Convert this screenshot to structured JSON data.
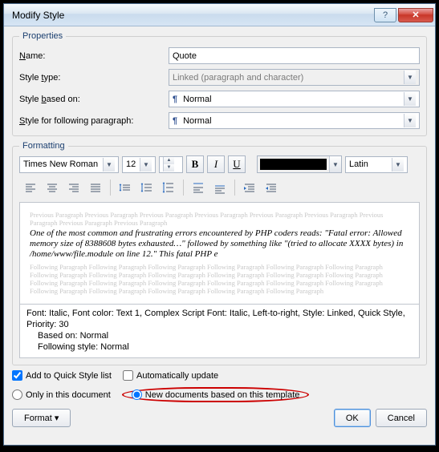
{
  "window": {
    "title": "Modify Style"
  },
  "properties": {
    "legend": "Properties",
    "name_label": "Name:",
    "name_value": "Quote",
    "type_label": "Style type:",
    "type_value": "Linked (paragraph and character)",
    "based_label": "Style based on:",
    "based_value": "Normal",
    "following_label": "Style for following paragraph:",
    "following_value": "Normal"
  },
  "formatting": {
    "legend": "Formatting",
    "font": "Times New Roman",
    "size": "12",
    "script": "Latin"
  },
  "preview": {
    "ghost_prev": "Previous Paragraph Previous Paragraph Previous Paragraph Previous Paragraph Previous Paragraph Previous Paragraph Previous Paragraph Previous Paragraph Previous Paragraph",
    "sample": "One of the most common and frustrating errors encountered by PHP coders reads: \"Fatal error: Allowed memory size of 8388608 bytes exhausted…\" followed by something like \"(tried to allocate XXXX bytes) in /home/www/file.module on line 12.\" This fatal PHP e",
    "ghost_follow": "Following Paragraph Following Paragraph Following Paragraph Following Paragraph Following Paragraph Following Paragraph Following Paragraph Following Paragraph Following Paragraph Following Paragraph Following Paragraph Following Paragraph Following Paragraph Following Paragraph Following Paragraph Following Paragraph Following Paragraph Following Paragraph Following Paragraph Following Paragraph Following Paragraph Following Paragraph Following Paragraph"
  },
  "description": {
    "line1": "Font: Italic, Font color: Text 1, Complex Script Font: Italic, Left-to-right, Style: Linked, Quick Style, Priority: 30",
    "line2": "Based on: Normal",
    "line3": "Following style: Normal"
  },
  "options": {
    "quick_style": "Add to Quick Style list",
    "auto_update": "Automatically update",
    "only_doc": "Only in this document",
    "new_docs": "New documents based on this template"
  },
  "buttons": {
    "format": "Format ▾",
    "ok": "OK",
    "cancel": "Cancel"
  }
}
